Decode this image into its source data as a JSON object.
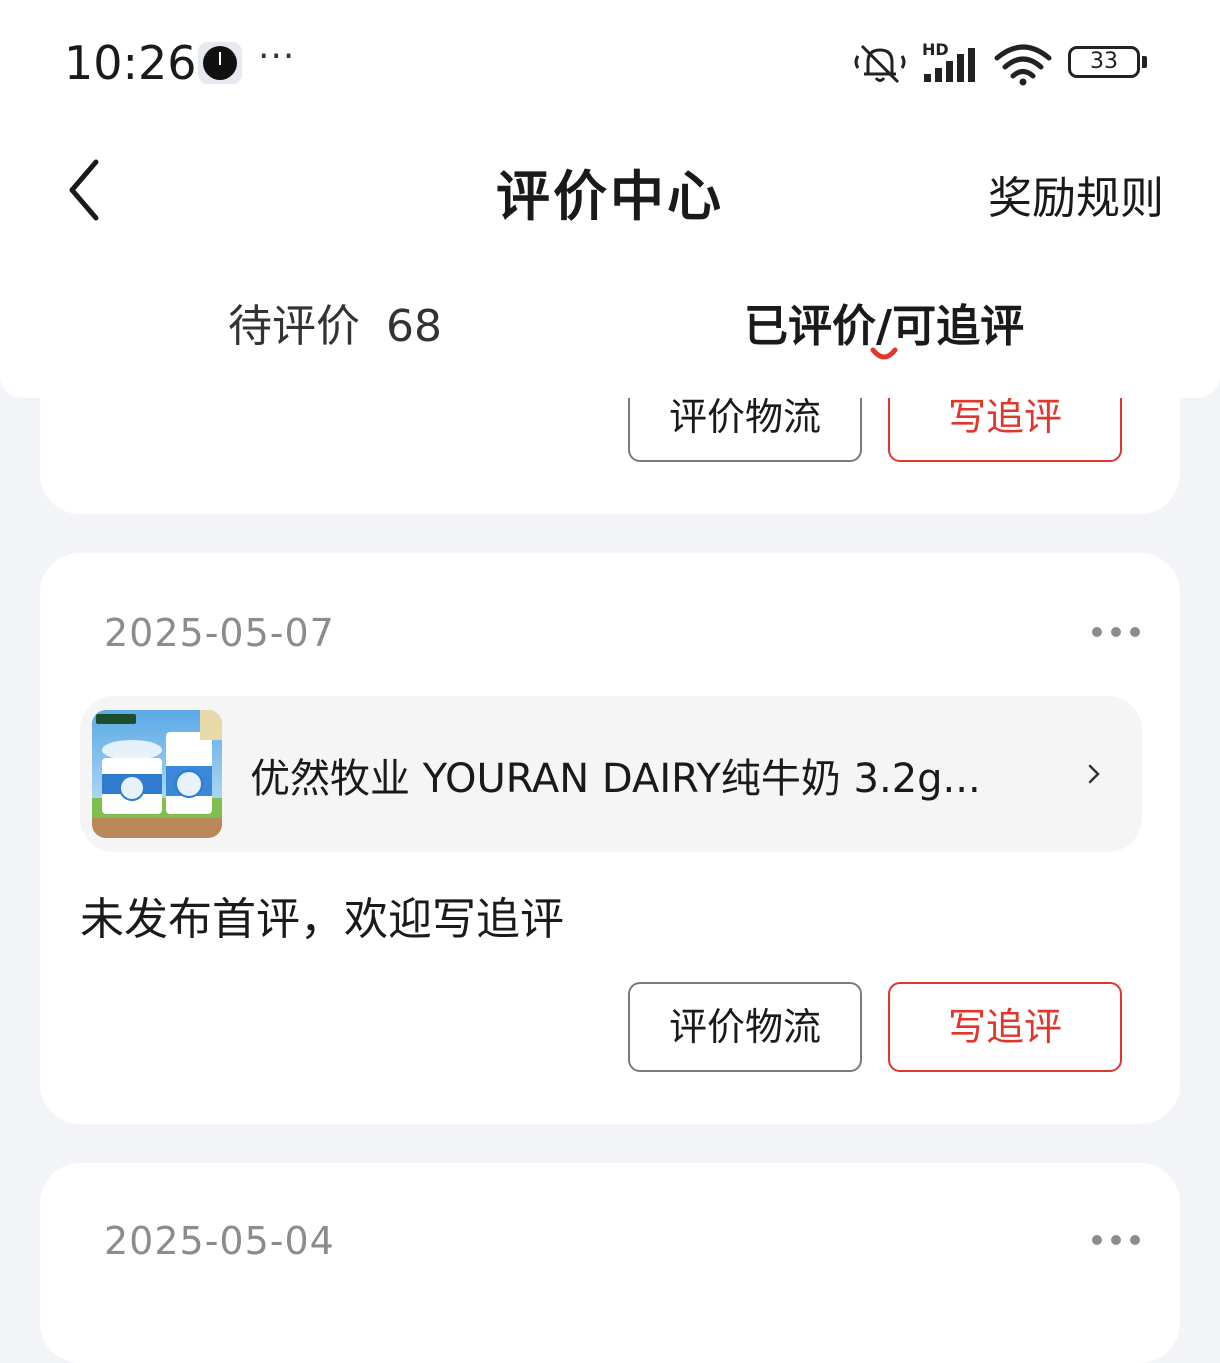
{
  "status_bar": {
    "time": "10:26",
    "extra": "···",
    "network": "HD",
    "battery": "33",
    "icons": [
      "alarm-clock-icon",
      "mute-bell-icon",
      "signal-icon",
      "wifi-icon",
      "battery-icon"
    ]
  },
  "header": {
    "title": "评价中心",
    "reward_rules": "奖励规则"
  },
  "tabs": {
    "pending": {
      "label": "待评价",
      "count": "68"
    },
    "reviewed": {
      "label": "已评价/可追评"
    }
  },
  "buttons": {
    "rate_logistics": "评价物流",
    "write_followup": "写追评"
  },
  "cards": [
    {
      "date": "2025-05-07",
      "product_name": "优然牧业 YOURAN DAIRY纯牛奶  3.2g...",
      "review_text": "未发布首评，欢迎写追评"
    },
    {
      "date": "2025-05-04"
    }
  ],
  "colors": {
    "accent_red": "#e0362c",
    "page_bg": "#f3f4f8",
    "muted_text": "#8c8c8c"
  }
}
